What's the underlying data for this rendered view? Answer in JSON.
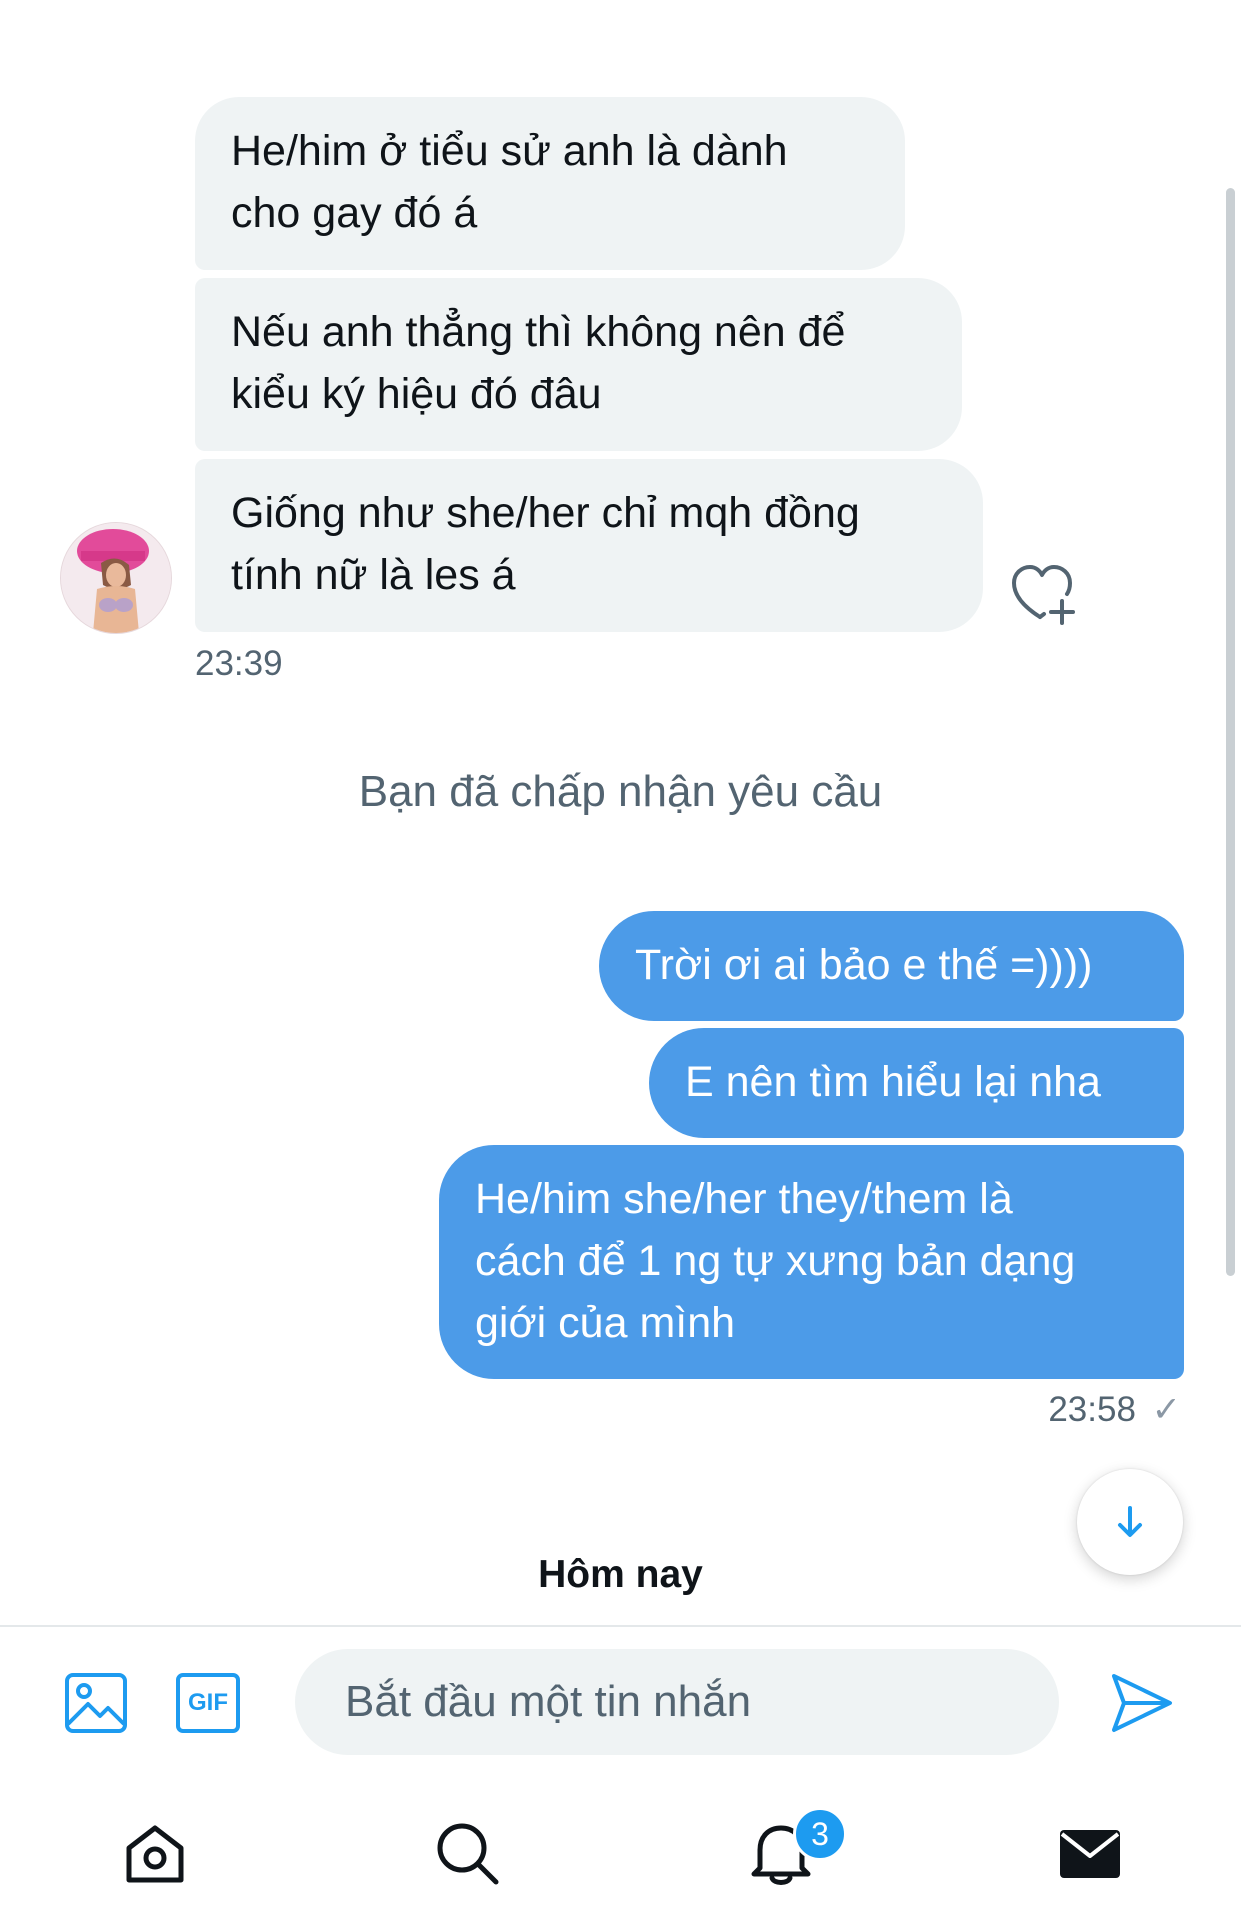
{
  "conversation": {
    "incoming": [
      {
        "lines": [
          "He/him ở tiểu sử anh là dành",
          "cho gay đó á"
        ]
      },
      {
        "lines": [
          "Nếu anh thẳng thì không nên để",
          "kiểu ký hiệu đó đâu"
        ]
      },
      {
        "lines": [
          "Giống như she/her chỉ mqh đồng",
          "tính nữ là les á"
        ]
      }
    ],
    "incoming_time": "23:39",
    "system_notice": "Bạn đã chấp nhận yêu cầu",
    "outgoing": [
      {
        "lines": [
          "Trời ơi ai bảo e thế =))))"
        ]
      },
      {
        "lines": [
          "E nên tìm hiểu lại nha"
        ]
      },
      {
        "lines": [
          "He/him she/her they/them là",
          "cách để 1 ng tự xưng bản dạng",
          "giới của mình"
        ]
      }
    ],
    "outgoing_time": "23:58",
    "read_mark": "✓",
    "day_separator": "Hôm nay"
  },
  "composer": {
    "placeholder": "Bắt đầu một tin nhắn",
    "gif_label": "GIF"
  },
  "bottom_nav": {
    "notifications_count": "3"
  },
  "colors": {
    "outgoing_bubble": "#4c9be8",
    "incoming_bubble": "#eff3f4",
    "accent": "#1d9bf0"
  }
}
